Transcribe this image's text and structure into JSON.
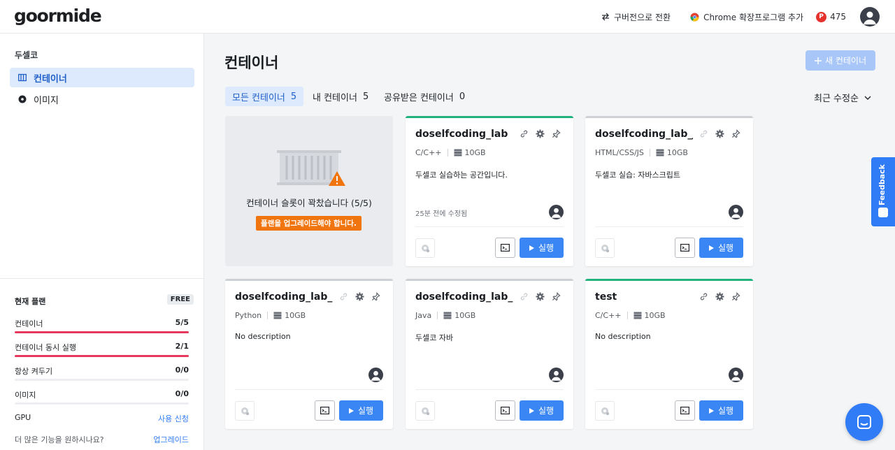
{
  "app": {
    "logo": "goormide"
  },
  "topbar": {
    "legacy": "구버전으로 전환",
    "chrome": "Chrome 확장프로그램 추가",
    "points": "475",
    "points_badge": "P"
  },
  "sidebar": {
    "section": "두셀코",
    "items": [
      {
        "label": "컨테이너",
        "icon": "container-icon"
      },
      {
        "label": "이미지",
        "icon": "image-disc-icon"
      }
    ],
    "plan": {
      "title": "현재 플랜",
      "badge": "FREE",
      "rows": [
        {
          "label": "컨테이너",
          "value": "5/5",
          "fill": 1.0
        },
        {
          "label": "컨테이너 동시 실행",
          "value": "2/1",
          "fill": 1.0
        },
        {
          "label": "항상 켜두기",
          "value": "0/0",
          "fill": 0
        },
        {
          "label": "이미지",
          "value": "0/0",
          "fill": 0
        }
      ],
      "gpu_label": "GPU",
      "gpu_link": "사용 신청",
      "more_label": "더 많은 기능을 원하시나요?",
      "more_link": "업그레이드"
    }
  },
  "main": {
    "title": "컨테이너",
    "new_button": "새 컨테이너",
    "tabs": [
      {
        "label": "모든 컨테이너",
        "count": "5"
      },
      {
        "label": "내 컨테이너",
        "count": "5"
      },
      {
        "label": "공유받은 컨테이너",
        "count": "0"
      }
    ],
    "sort": "최근 수정순",
    "full_slot": {
      "message": "컨테이너 슬롯이 꽉찼습니다 (5/5)",
      "warning": "플랜을 업그레이드해야 합니다."
    },
    "run_label": "실행",
    "cards": [
      {
        "title": "doselfcoding_lab",
        "stack": "C/C++",
        "storage": "10GB",
        "desc": "두셀코 실습하는 공간입니다.",
        "time": "25분 전에 수정됨",
        "status_color": "#21b27d"
      },
      {
        "title": "doselfcoding_lab_js",
        "stack": "HTML/CSS/JS",
        "storage": "10GB",
        "desc": "두셀코 실습: 자바스크립트",
        "time": "",
        "status_color": "#cdd1d6"
      },
      {
        "title": "doselfcoding_lab_...",
        "stack": "Python",
        "storage": "10GB",
        "desc": "No description",
        "time": "",
        "status_color": "#cdd1d6"
      },
      {
        "title": "doselfcoding_lab_...",
        "stack": "Java",
        "storage": "10GB",
        "desc": "두셀코 자바",
        "time": "",
        "status_color": "#cdd1d6"
      },
      {
        "title": "test",
        "stack": "C/C++",
        "storage": "10GB",
        "desc": "No description",
        "time": "",
        "status_color": "#21b27d"
      }
    ]
  },
  "widgets": {
    "feedback": "Feedback"
  },
  "colors": {
    "accent": "#2f7cf6",
    "danger": "#e8385b",
    "warning": "#f0750f",
    "running": "#21b27d"
  }
}
